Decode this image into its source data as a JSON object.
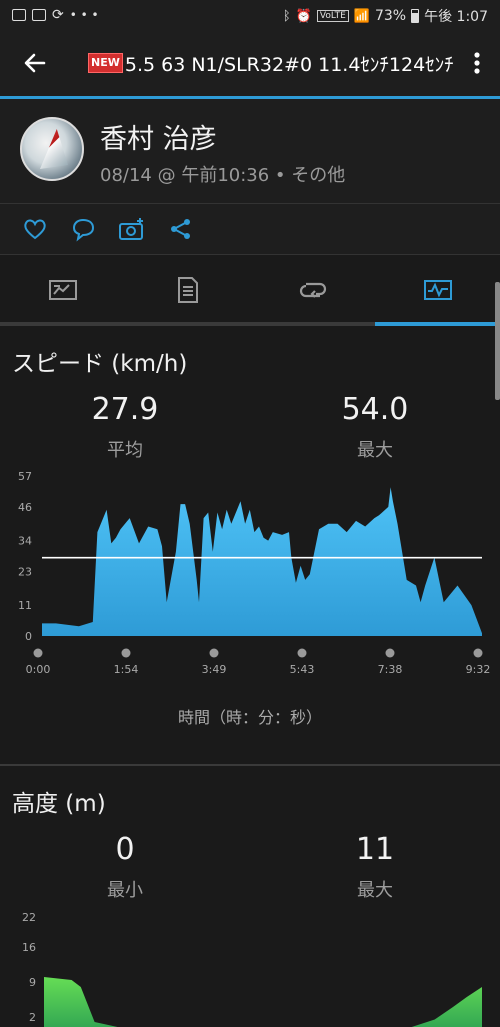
{
  "status_bar": {
    "battery": "73%",
    "time": "午後 1:07"
  },
  "toolbar": {
    "new_badge": "NEW",
    "title": "5.5 63 N1/SLR32#0 11.4ｾﾝﾁ124ｾﾝﾁ"
  },
  "profile": {
    "name": "香村 治彦",
    "meta": "08/14 @ 午前10:36 • その他"
  },
  "actions": [
    "heart-icon",
    "comment-icon",
    "add-photo-icon",
    "share-icon"
  ],
  "tabs": [
    "summary",
    "details",
    "laps",
    "charts"
  ],
  "speed": {
    "title": "スピード (km/h)",
    "avg_value": "27.9",
    "avg_label": "平均",
    "max_value": "54.0",
    "max_label": "最大",
    "x_axis_title": "時間（時：分：秒）"
  },
  "altitude": {
    "title": "高度 (m)",
    "min_value": "0",
    "min_label": "最小",
    "max_value": "11",
    "max_label": "最大"
  },
  "chart_data": [
    {
      "type": "area",
      "title": "スピード (km/h)",
      "y_ticks": [
        "57",
        "46",
        "34",
        "23",
        "11",
        "0"
      ],
      "ylim": [
        0,
        57
      ],
      "x_ticks": [
        "0:00",
        "1:54",
        "3:49",
        "5:43",
        "7:38",
        "9:32"
      ],
      "average_line": 27.9,
      "x_minutes": [
        0,
        0.3,
        0.8,
        1.1,
        1.2,
        1.4,
        1.5,
        1.6,
        1.7,
        1.9,
        2.1,
        2.3,
        2.5,
        2.6,
        2.7,
        2.9,
        3.0,
        3.1,
        3.2,
        3.35,
        3.4,
        3.5,
        3.6,
        3.7,
        3.8,
        3.9,
        4.0,
        4.1,
        4.3,
        4.4,
        4.5,
        4.6,
        4.7,
        4.8,
        4.9,
        5.0,
        5.2,
        5.35,
        5.4,
        5.5,
        5.6,
        5.7,
        5.8,
        6.0,
        6.2,
        6.4,
        6.6,
        6.8,
        7.0,
        7.2,
        7.3,
        7.5,
        7.55,
        7.6,
        7.7,
        7.9,
        8.1,
        8.2,
        8.3,
        8.5,
        8.7,
        9.0,
        9.3,
        9.53
      ],
      "values": [
        4.5,
        4.5,
        3.5,
        5,
        37,
        45,
        33,
        35,
        38,
        42,
        33,
        39,
        38,
        32,
        12,
        30,
        47,
        47,
        40,
        20,
        12,
        42,
        44,
        30,
        44,
        38,
        45,
        40,
        48,
        40,
        45,
        37,
        39,
        35,
        34,
        37,
        36,
        37,
        28,
        19,
        25,
        20,
        22,
        38,
        40,
        40,
        37,
        41,
        39,
        42,
        43,
        46,
        53,
        48,
        40,
        20,
        18,
        12,
        18,
        28,
        12,
        18,
        11,
        1
      ],
      "color": "#2e9bd6"
    },
    {
      "type": "area",
      "title": "高度 (m)",
      "y_ticks": [
        "22",
        "16",
        "9",
        "2"
      ],
      "ylim": [
        0,
        22
      ],
      "x_minutes": [
        0,
        0.3,
        0.6,
        0.8,
        1.1,
        1.6,
        2.0,
        3.0,
        4.0,
        5.0,
        6.0,
        7.0,
        8.0,
        8.5,
        8.9,
        9.2,
        9.53
      ],
      "values": [
        10,
        9.7,
        9.4,
        8,
        1,
        0,
        0,
        0,
        0,
        0,
        0,
        0,
        0,
        1.5,
        4,
        6,
        8
      ],
      "color": "#34a853"
    }
  ]
}
